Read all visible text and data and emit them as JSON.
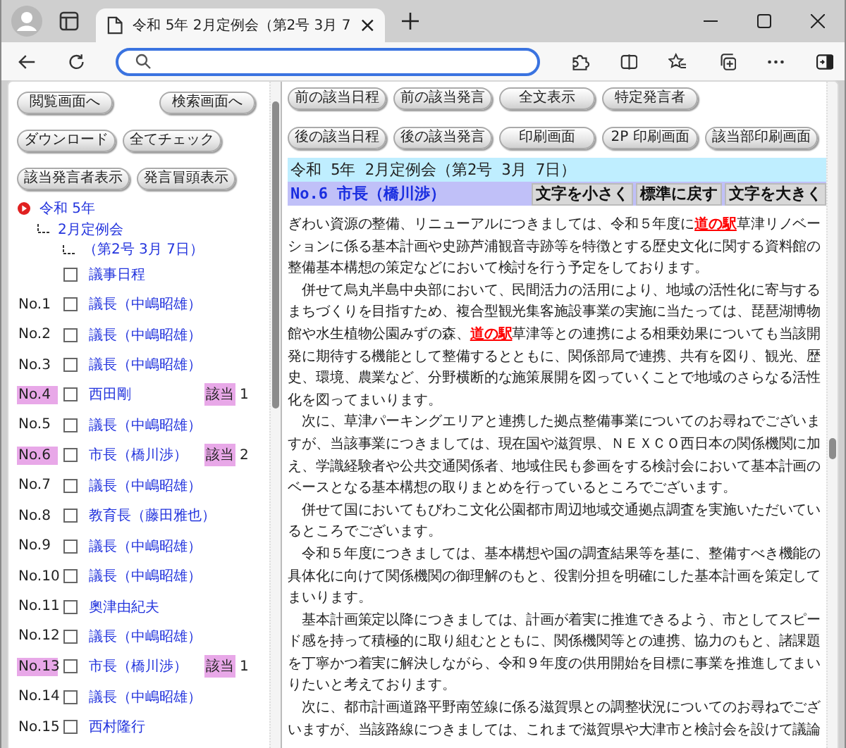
{
  "browser": {
    "tab_title": "令和 5年 2月定例会（第2号 3月 7"
  },
  "left_buttons": [
    [
      "閲覧画面へ",
      "検索画面へ"
    ],
    [
      "ダウンロード",
      "全てチェック"
    ],
    [
      "該当発言者表示",
      "発言冒頭表示"
    ]
  ],
  "tree": {
    "label": "令和 5年",
    "children": [
      {
        "label": "2月定例会",
        "children": [
          {
            "label": "（第2号 3月 7日）"
          }
        ]
      }
    ]
  },
  "speeches": [
    {
      "name": "議事日程",
      "checked": false,
      "hit": false
    },
    {
      "no": "No.1",
      "name": "議長（中嶋昭雄）",
      "checked": false,
      "hit": false
    },
    {
      "no": "No.2",
      "name": "議長（中嶋昭雄）",
      "checked": false,
      "hit": false
    },
    {
      "no": "No.3",
      "name": "議長（中嶋昭雄）",
      "checked": false,
      "hit": false
    },
    {
      "no": "No.4",
      "name": "西田剛",
      "checked": false,
      "hit": true,
      "hit_label": "該当",
      "hit_count": "1"
    },
    {
      "no": "No.5",
      "name": "議長（中嶋昭雄）",
      "checked": false,
      "hit": false
    },
    {
      "no": "No.6",
      "name": "市長（橋川渉）",
      "checked": false,
      "hit": true,
      "hit_label": "該当",
      "hit_count": "2"
    },
    {
      "no": "No.7",
      "name": "議長（中嶋昭雄）",
      "checked": false,
      "hit": false
    },
    {
      "no": "No.8",
      "name": "教育長（藤田雅也）",
      "checked": false,
      "hit": false
    },
    {
      "no": "No.9",
      "name": "議長（中嶋昭雄）",
      "checked": false,
      "hit": false
    },
    {
      "no": "No.10",
      "name": "議長（中嶋昭雄）",
      "checked": false,
      "hit": false
    },
    {
      "no": "No.11",
      "name": "奧津由紀夫",
      "checked": false,
      "hit": false
    },
    {
      "no": "No.12",
      "name": "議長（中嶋昭雄）",
      "checked": false,
      "hit": false
    },
    {
      "no": "No.13",
      "name": "市長（橋川渉）",
      "checked": false,
      "hit": true,
      "hit_label": "該当",
      "hit_count": "1"
    },
    {
      "no": "No.14",
      "name": "議長（中嶋昭雄）",
      "checked": false,
      "hit": false
    },
    {
      "no": "No.15",
      "name": "西村隆行",
      "checked": false,
      "hit": false
    }
  ],
  "right_buttons": [
    [
      "前の該当日程",
      "前の該当発言",
      "全文表示",
      "特定発言者"
    ],
    [
      "後の該当日程",
      "後の該当発言",
      "印刷画面",
      "2P 印刷画面",
      "該当部印刷画面"
    ]
  ],
  "meeting_title": "令和 5年 2月定例会（第2号 3月 7日）",
  "speaker": "No.6 市長（橋川渉）",
  "font_buttons": [
    "文字を小さく",
    "標準に戻す",
    "文字を大きく"
  ],
  "paragraphs": [
    [
      {
        "text": "ぎわい資源の整備、リニューアルにつきましては、令和５年度に"
      },
      {
        "link": "道の駅"
      },
      {
        "text": "草津リノベーションに係る基本計画や史跡芦浦観音寺跡等を特徴とする歴史文化に関する資料館の整備基本構想の策定などにおいて検討を行う予定をしております。"
      }
    ],
    [
      {
        "text": "　併せて烏丸半島中央部において、民間活力の活用により、地域の活性化に寄与するまちづくりを目指すため、複合型観光集客施設事業の実施に当たっては、琵琶湖博物館や水生植物公園みずの森、"
      },
      {
        "link": "道の駅"
      },
      {
        "text": "草津等との連携による相乗効果についても当該開発に期待する機能として整備するとともに、関係部局で連携、共有を図り、観光、歴史、環境、農業など、分野横断的な施策展開を図っていくことで地域のさらなる活性化を図ってまいります。"
      }
    ],
    [
      {
        "text": "　次に、草津パーキングエリアと連携した拠点整備事業についてのお尋ねでございますが、当該事業につきましては、現在国や滋賀県、ＮＥＸＣＯ西日本の関係機関に加え、学識経験者や公共交通関係者、地域住民も参画をする検討会において基本計画のベースとなる基本構想の取りまとめを行っているところでございます。"
      }
    ],
    [
      {
        "text": "　併せて国においてもびわこ文化公園都市周辺地域交通拠点調査を実施いただいているところでございます。"
      }
    ],
    [
      {
        "text": "　令和５年度につきましては、基本構想や国の調査結果等を基に、整備すべき機能の具体化に向けて関係機関の御理解のもと、役割分担を明確にした基本計画を策定してまいります。"
      }
    ],
    [
      {
        "text": "　基本計画策定以降につきましては、計画が着実に推進できるよう、市としてスピード感を持って積極的に取り組むとともに、関係機関等との連携、協力のもと、諸課題を丁寧かつ着実に解決しながら、令和９年度の供用開始を目標に事業を推進してまいりたいと考えております。"
      }
    ],
    [
      {
        "text": "　次に、都市計画道路平野南笠線に係る滋賀県との調整状況についてのお尋ねでございますが、当該路線につきましては、これまで滋賀県や大津市と検討会を設けて議論"
      }
    ]
  ]
}
